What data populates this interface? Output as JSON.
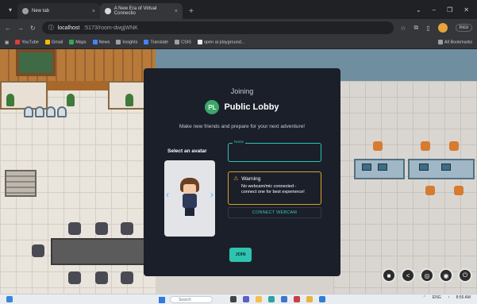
{
  "browser": {
    "tabs": [
      {
        "title": "New tab",
        "active": false
      },
      {
        "title": "A New Era of Virtual Connectio",
        "active": true
      }
    ],
    "new_tab": "+",
    "address": {
      "host": "localhost",
      "path": ":5173/room-dwgjWNK"
    },
    "bookmarks": [
      "YouTube",
      "Gmail",
      "Maps",
      "News",
      "Insights",
      "Translate",
      "CSIS",
      "open ai playground..."
    ],
    "all_bookmarks": "All Bookmarks",
    "profile_label": "Inco"
  },
  "modal": {
    "heading": "Joining",
    "room_badge": "PL",
    "room_name": "Public Lobby",
    "subtitle": "Make new friends and prepare for your next adventure!",
    "select_avatar": "Select an avatar",
    "name_label": "Name",
    "name_value": "",
    "warning_title": "Warning",
    "warning_line1": "No webcam/mic connected -",
    "warning_line2": "connect one for best experience!",
    "connect_button": "CONNECT WEBCAM",
    "join_button": "JOIN"
  },
  "taskbar": {
    "search_placeholder": "Search",
    "language": "ENG",
    "time": "8:56 AM"
  },
  "colors": {
    "accent": "#2ec4b0",
    "warning": "#d9a31f",
    "modal_bg": "#1b1f2a"
  }
}
